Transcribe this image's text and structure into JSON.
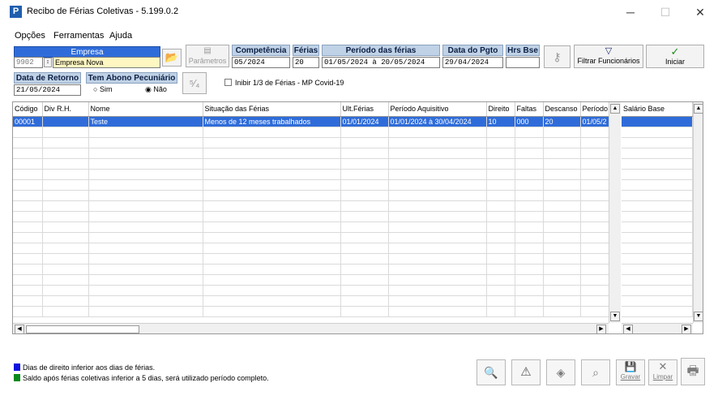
{
  "window": {
    "app_icon": "P",
    "title": "Recibo de Férias Coletivas - 5.199.0.2",
    "minimize": "─",
    "maximize": "☐",
    "close": "✕"
  },
  "menu": [
    "Opções",
    "Ferramentas",
    "Ajuda"
  ],
  "empresa": {
    "label": "Empresa",
    "code": "9902",
    "name": "Empresa Nova"
  },
  "parametros_label": "Parâmetros",
  "competencia": {
    "label": "Competência",
    "value": "05/2024"
  },
  "ferias": {
    "label": "Férias",
    "value": "20"
  },
  "periodo_ferias": {
    "label": "Período das férias",
    "start": "01/05/2024",
    "separator": "à",
    "end": "20/05/2024"
  },
  "data_pgto": {
    "label": "Data do Pgto",
    "value": "29/04/2024"
  },
  "hrs_bse": {
    "label": "Hrs Bse",
    "value": ""
  },
  "filtrar_label": "Filtrar Funcionários",
  "iniciar_label": "Iniciar",
  "data_retorno": {
    "label": "Data de Retorno",
    "value": "21/05/2024"
  },
  "abono": {
    "label": "Tem Abono Pecuniário",
    "options": [
      "Sim",
      "Não"
    ],
    "selected": "Não"
  },
  "inibir_label": "Inibir 1/3 de Férias - MP Covid-19",
  "table": {
    "columns": [
      "Código",
      "Div R.H.",
      "Nome",
      "Situação das Férias",
      "Ult.Férias",
      "Período Aquisitivo",
      "Direito",
      "Faltas",
      "Descanso",
      "Período"
    ],
    "rows": [
      [
        "00001",
        "",
        "Teste",
        "Menos de 12 meses trabalhados",
        "01/01/2024",
        "01/01/2024 à 30/04/2024",
        "10",
        "000",
        "20",
        "01/05/2"
      ]
    ],
    "side_column": "Salário Base"
  },
  "legend": [
    {
      "color": "#1010e0",
      "text": "Dias de direito inferior aos dias de férias."
    },
    {
      "color": "#0a8a1a",
      "text": "Saldo após férias coletivas inferior a 5 dias, será utilizado período completo."
    }
  ],
  "footer_buttons": {
    "gravar": "Gravar",
    "limpar": "Limpar"
  }
}
